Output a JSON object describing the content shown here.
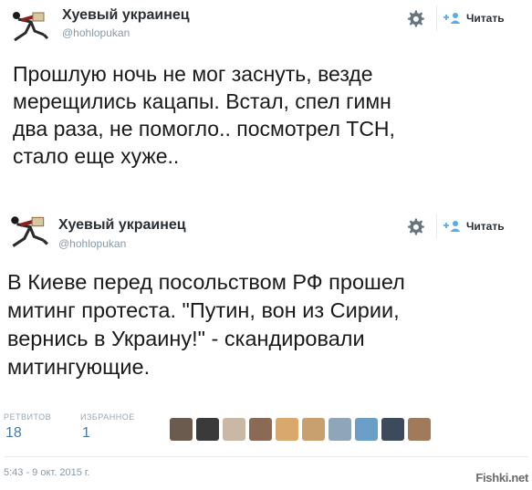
{
  "tweets": [
    {
      "author": {
        "name": "Хуевый украинец",
        "handle": "@hohlopukan",
        "avatar_icon": "running-man-avatar"
      },
      "follow_label": "Читать",
      "lines": [
        "Прошлую ночь не мог заснуть, везде",
        "мерещились кацапы. Встал, спел гимн",
        "два раза, не помогло.. посмотрел ТСН,",
        "стало еще хуже.."
      ]
    },
    {
      "author": {
        "name": "Хуевый украинец",
        "handle": "@hohlopukan",
        "avatar_icon": "running-man-avatar"
      },
      "follow_label": "Читать",
      "lines": [
        "В Киеве перед посольством РФ прошел",
        "митинг протеста. \"Путин, вон из Сирии,",
        "вернись в Украину!\" - скандировали",
        "митингующие."
      ],
      "stats": {
        "retweets_label": "РЕТВИТОВ",
        "retweets": "18",
        "likes_label": "ИЗБРАННОЕ",
        "likes": "1"
      },
      "timestamp": "5:43 - 9 окт. 2015 г."
    }
  ],
  "watermark": "Fishki.net",
  "colors": {
    "link_blue": "#4a7aa8",
    "muted_gray": "#8899a6",
    "follow_blue": "#55acee",
    "divider": "#e6ecf0"
  },
  "favoriter_avatar_colors": [
    "#6b5a4e",
    "#3a3a3a",
    "#c9b8a6",
    "#8a6a55",
    "#d9a86c",
    "#c8a070",
    "#8fa6b8",
    "#6aa0c8",
    "#3c4a5a",
    "#a07a5a"
  ]
}
